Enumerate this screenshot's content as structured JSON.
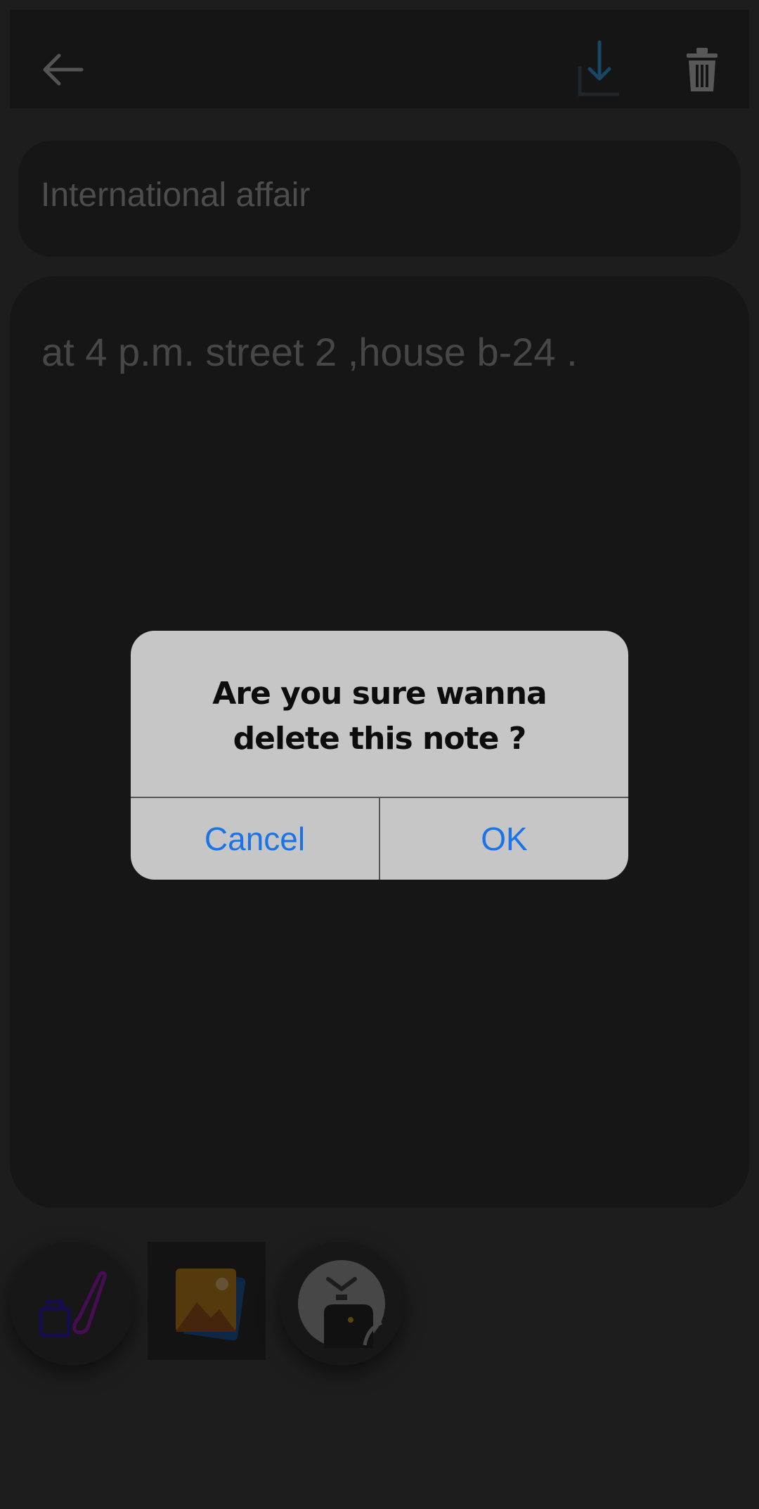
{
  "topbar": {
    "back_icon": "arrow-left-icon",
    "save_icon": "download-icon",
    "delete_icon": "trash-icon"
  },
  "note": {
    "title": "International affair",
    "body": "at 4 p.m. street 2 ,house b-24 ."
  },
  "tools": [
    {
      "name": "brush-ink-icon"
    },
    {
      "name": "gallery-icon"
    },
    {
      "name": "clock-reminder-icon"
    }
  ],
  "dialog": {
    "message": "Are you sure wanna delete this note ?",
    "cancel_label": "Cancel",
    "ok_label": "OK"
  },
  "colors": {
    "accent": "#1a73e8",
    "dialog_bg": "#c6c6c6",
    "card_bg": "#2c2c2c"
  }
}
